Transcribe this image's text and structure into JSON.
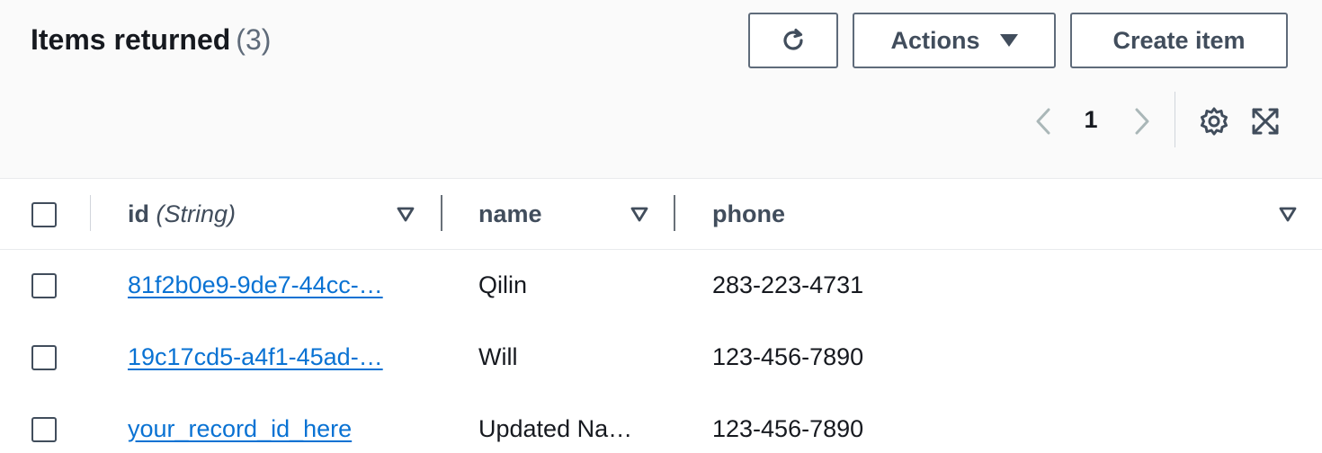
{
  "header": {
    "title": "Items returned",
    "count": "(3)"
  },
  "toolbar": {
    "refresh_icon": "refresh-icon",
    "actions_label": "Actions",
    "create_label": "Create item"
  },
  "pagination": {
    "current_page": "1",
    "prev_icon": "chevron-left-icon",
    "next_icon": "chevron-right-icon",
    "settings_icon": "gear-icon",
    "fullscreen_icon": "expand-icon"
  },
  "table": {
    "columns": [
      {
        "label": "id",
        "type": "(String)"
      },
      {
        "label": "name"
      },
      {
        "label": "phone"
      }
    ],
    "rows": [
      {
        "id": "81f2b0e9-9de7-44cc-…",
        "name": "Qilin",
        "phone": "283-223-4731"
      },
      {
        "id": "19c17cd5-a4f1-45ad-…",
        "name": "Will",
        "phone": "123-456-7890"
      },
      {
        "id": "your_record_id_here",
        "name": "Updated Na…",
        "phone": "123-456-7890"
      }
    ]
  },
  "colors": {
    "link": "#0972d3",
    "text": "#16191f",
    "muted": "#5f6b7a",
    "border": "#5f6b7a"
  }
}
